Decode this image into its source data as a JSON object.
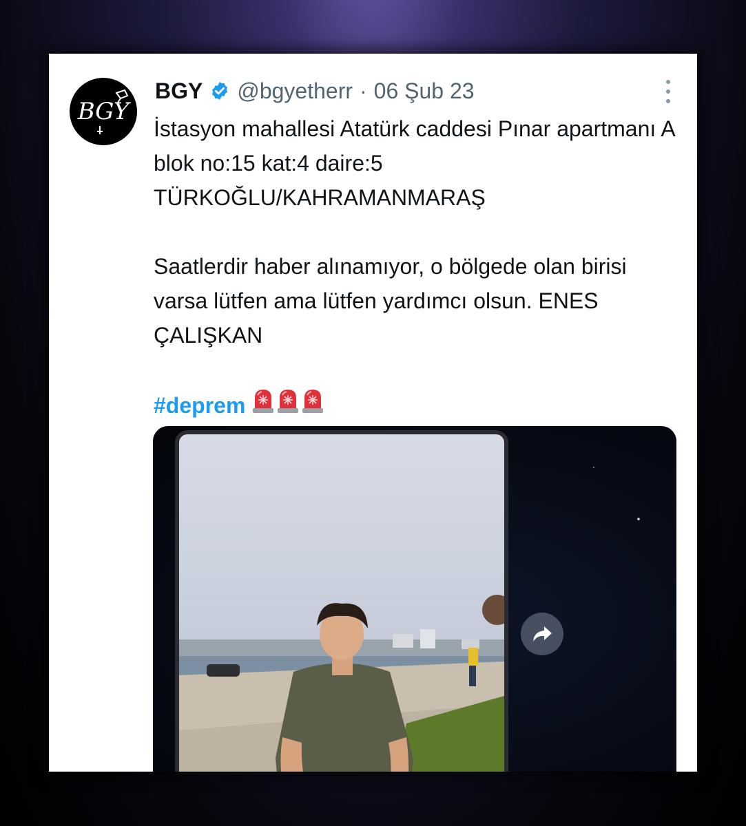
{
  "tweet": {
    "display_name": "BGY",
    "handle": "@bgyetherr",
    "separator": "·",
    "date": "06 Şub 23",
    "avatar_text": "BGY",
    "paragraphs": [
      "İstasyon mahallesi Atatürk caddesi Pınar apartmanı A blok no:15 kat:4  daire:5 TÜRKOĞLU/KAHRAMANMARAŞ",
      "Saatlerdir haber alınamıyor, o bölgede olan birisi varsa lütfen ama lütfen yardımcı olsun. ENES ÇALIŞKAN"
    ],
    "hashtag": "#deprem",
    "emoji_count": 3
  },
  "icons": {
    "verified": "verified-badge-icon",
    "more": "more-options-icon",
    "siren": "police-siren-emoji-icon",
    "share": "share-arrow-icon"
  },
  "colors": {
    "link": "#1d9bf0",
    "verified": "#1d9bf0",
    "text": "#0f1419",
    "muted": "#536471"
  }
}
